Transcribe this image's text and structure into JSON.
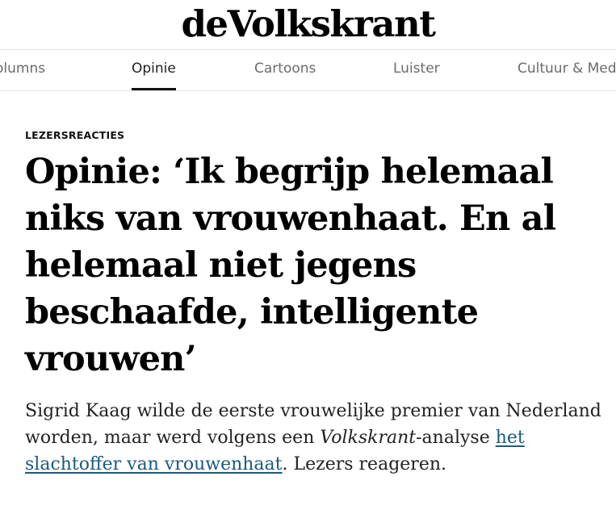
{
  "header": {
    "logo_text": "deVolkskrant"
  },
  "nav": {
    "items": [
      {
        "label": "olumns"
      },
      {
        "label": "Opinie",
        "active": true
      },
      {
        "label": "Cartoons"
      },
      {
        "label": "Luister"
      },
      {
        "label": "Cultuur & Medi"
      }
    ]
  },
  "article": {
    "kicker": "LEZERSREACTIES",
    "headline": "Opinie: ‘Ik begrijp helemaal niks van vrouwenhaat. En al helemaal niet jegens beschaafde, intelligente vrouwen’",
    "intro": {
      "part1": "Sigrid Kaag wilde de eerste vrouwelijke premier van Nederland worden, maar werd volgens een ",
      "italic": "Volkskrant",
      "part2": "-analyse ",
      "link_text": "het slachtoffer van vrouwenhaat",
      "part3": ". Lezers reageren."
    }
  },
  "colors": {
    "link": "#1a5a7e",
    "nav_inactive": "#6b6b6b",
    "nav_active_underline": "#111111"
  }
}
